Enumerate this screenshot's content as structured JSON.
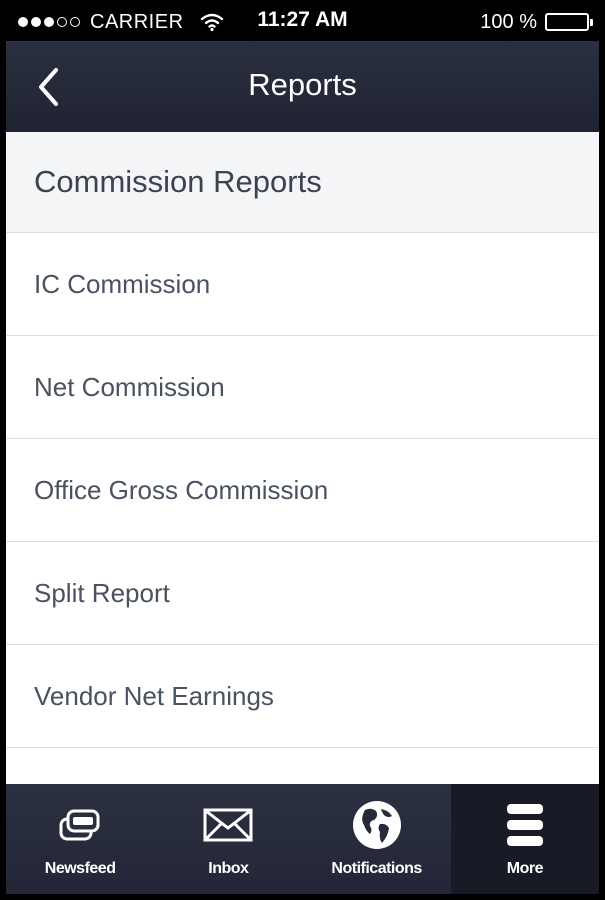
{
  "status_bar": {
    "carrier": "CARRIER",
    "time": "11:27 AM",
    "battery": "100 %",
    "signal_bars_filled": 3,
    "signal_bars_total": 5
  },
  "nav": {
    "title": "Reports",
    "back_icon": "chevron-left-icon"
  },
  "section": {
    "title": "Commission Reports"
  },
  "reports": [
    "IC Commission",
    "Net Commission",
    "Office Gross Commission",
    "Split Report",
    "Vendor Net Earnings"
  ],
  "tabs": [
    {
      "label": "Newsfeed",
      "icon": "newsfeed-icon"
    },
    {
      "label": "Inbox",
      "icon": "envelope-icon"
    },
    {
      "label": "Notifications",
      "icon": "globe-icon"
    },
    {
      "label": "More",
      "icon": "menu-icon",
      "active": true
    }
  ],
  "colors": {
    "nav_background": "#262a39",
    "tab_active_background": "#181b26",
    "section_background": "#f4f5f7",
    "text": "#4a5160"
  }
}
